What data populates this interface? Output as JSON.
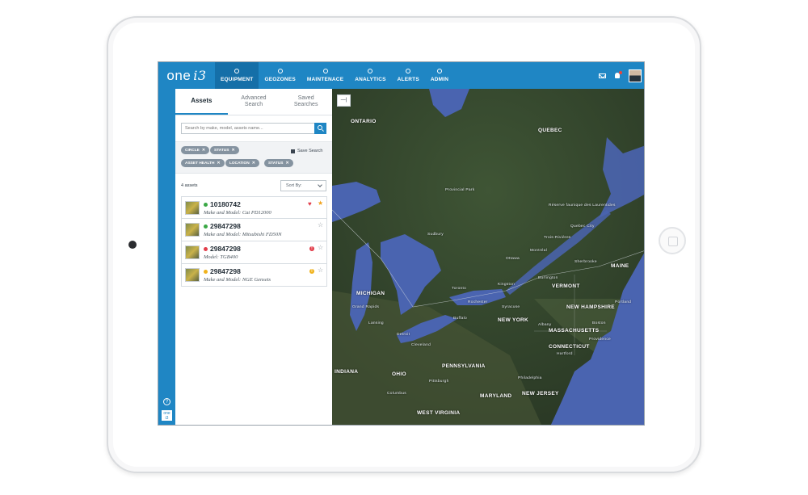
{
  "nav": {
    "logo_text": "one",
    "logo_mark": "i3",
    "items": [
      {
        "label": "EQUIPMENT",
        "icon": "map-pin-icon",
        "active": true
      },
      {
        "label": "GEOZONES",
        "icon": "globe-icon",
        "active": false
      },
      {
        "label": "MAINTENACE",
        "icon": "wrench-icon",
        "active": false
      },
      {
        "label": "ANALYTICS",
        "icon": "pie-chart-icon",
        "active": false
      },
      {
        "label": "ALERTS",
        "icon": "alert-icon",
        "active": false
      },
      {
        "label": "ADMIN",
        "icon": "gear-icon",
        "active": false
      }
    ],
    "right_icons": [
      "mail-icon",
      "bell-icon",
      "user-avatar"
    ]
  },
  "panel": {
    "tabs": [
      {
        "label": "Assets",
        "active": true
      },
      {
        "label": "Advanced Search",
        "active": false
      },
      {
        "label": "Saved Searches",
        "active": false
      }
    ],
    "search": {
      "placeholder": "Search by make, model, assets name...",
      "value": ""
    },
    "filters": [
      "CIRCLE",
      "STATUS",
      "ASSET HEALTH",
      "LOCATION",
      "STATUS"
    ],
    "save_search_label": "Save Search",
    "count_label": "4 assets",
    "sort_label": "Sort By:",
    "assets": [
      {
        "id": "10180742",
        "subtitle": "Make and Model: Cat PD12000",
        "status_color": "#3aa845",
        "health_icon": "heart-icon",
        "starred": true
      },
      {
        "id": "29847298",
        "subtitle": "Make and Model: Mitsubishi FD50N",
        "status_color": "#3aa845",
        "health_icon": "",
        "starred": false
      },
      {
        "id": "29847298",
        "subtitle": "Model: TGB400",
        "status_color": "#e23d4a",
        "health_icon": "alert-red-icon",
        "starred": false
      },
      {
        "id": "29847298",
        "subtitle": "Make and Model: NGE Gensets",
        "status_color": "#f0b21c",
        "health_icon": "alert-yellow-icon",
        "starred": false
      }
    ]
  },
  "rail": {
    "help_icon": "help-icon",
    "logo_text": "one i3"
  },
  "map": {
    "collapse_label": "—|",
    "labels_big": [
      "ONTARIO",
      "QUEBEC",
      "MAINE",
      "VERMONT",
      "NEW HAMPSHIRE",
      "MASSACHUSETTS",
      "CONNECTICUT",
      "NEW YORK",
      "MICHIGAN",
      "PENNSYLVANIA",
      "OHIO",
      "INDIANA",
      "MARYLAND",
      "NEW JERSEY",
      "WEST VIRGINIA"
    ],
    "labels_small": [
      "Provincial Park",
      "Réserve faunique des Laurentides",
      "Quebec City",
      "Montréal",
      "Ottawa",
      "Toronto",
      "Kingston",
      "Sudbury",
      "Detroit",
      "Cleveland",
      "Grand Rapids",
      "Lansing",
      "Pittsburgh",
      "Columbus",
      "Philadelphia",
      "Boston",
      "Albany",
      "Buffalo",
      "Rochester",
      "Syracuse",
      "Hartford",
      "Providence",
      "Trois-Rivières",
      "Sherbrooke",
      "Portland",
      "Burlington"
    ]
  },
  "colors": {
    "nav_blue": "#1f86c4",
    "nav_active": "#156fa8",
    "chip_gray": "#8593a0",
    "water": "#4a64b0",
    "land": "#34452e"
  }
}
